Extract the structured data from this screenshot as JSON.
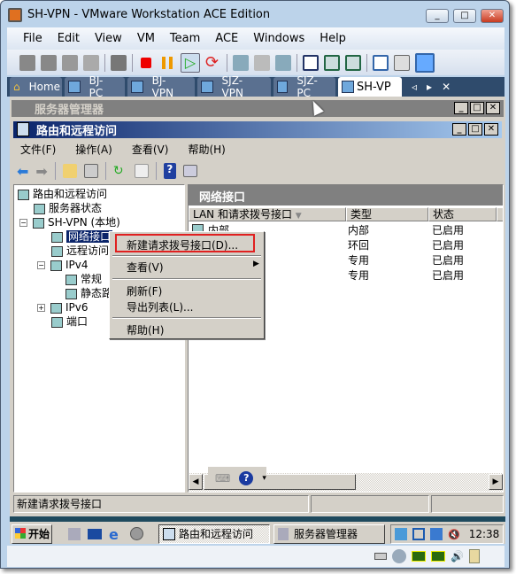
{
  "window": {
    "title": "SH-VPN - VMware Workstation ACE Edition"
  },
  "menu": [
    "File",
    "Edit",
    "View",
    "VM",
    "Team",
    "ACE",
    "Windows",
    "Help"
  ],
  "tabs": [
    {
      "label": "Home"
    },
    {
      "label": "BJ-PC"
    },
    {
      "label": "BJ-VPN"
    },
    {
      "label": "SJZ-VPN"
    },
    {
      "label": "SJZ-PC"
    },
    {
      "label": "SH-VP",
      "active": true
    }
  ],
  "server_manager": {
    "title": "服务器管理器"
  },
  "rras": {
    "title": "路由和远程访问",
    "menu": [
      "文件(F)",
      "操作(A)",
      "查看(V)",
      "帮助(H)"
    ],
    "tree": [
      {
        "label": "路由和远程访问",
        "level": 0
      },
      {
        "label": "服务器状态",
        "level": 1
      },
      {
        "label": "SH-VPN (本地)",
        "level": 1,
        "expander": "−"
      },
      {
        "label": "网络接口",
        "level": 2,
        "selected": true
      },
      {
        "label": "远程访问",
        "level": 2
      },
      {
        "label": "IPv4",
        "level": 2,
        "expander": "−"
      },
      {
        "label": "常规",
        "level": 3
      },
      {
        "label": "静态路",
        "level": 3
      },
      {
        "label": "IPv6",
        "level": 2,
        "expander": "+"
      },
      {
        "label": "端口",
        "level": 2
      }
    ],
    "pane_title": "网络接口",
    "columns": [
      "LAN 和请求拨号接口",
      "类型",
      "状态"
    ],
    "rows": [
      {
        "name": "内部",
        "type": "内部",
        "status": "已启用"
      },
      {
        "name": "",
        "type": "环回",
        "status": "已启用"
      },
      {
        "name": "",
        "type": "专用",
        "status": "已启用"
      },
      {
        "name": "",
        "type": "专用",
        "status": "已启用"
      }
    ],
    "status_text": "新建请求拨号接口"
  },
  "context_menu": [
    {
      "label": "新建请求拨号接口(D)...",
      "highlighted": true
    },
    {
      "label": "查看(V)",
      "submenu": true
    },
    {
      "label": "刷新(F)"
    },
    {
      "label": "导出列表(L)..."
    },
    {
      "label": "帮助(H)"
    }
  ],
  "taskbar": {
    "start": "开始",
    "buttons": [
      "路由和远程访问",
      "服务器管理器"
    ],
    "clock": "12:38"
  },
  "colors": {
    "highlight_box": "#e02020",
    "caption_active": "#0a246a",
    "selection": "#0a246a"
  }
}
